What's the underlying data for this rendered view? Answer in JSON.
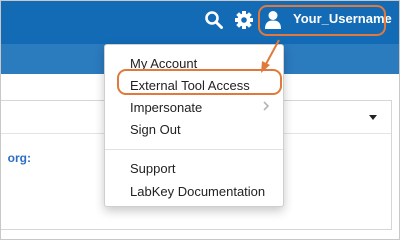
{
  "colors": {
    "header_bg": "#136bb5",
    "subbar_bg": "#2b7bbf",
    "annotation": "#e07a3c",
    "link": "#2b6cc4"
  },
  "header": {
    "icons": [
      "search-icon",
      "gear-icon",
      "user-icon"
    ],
    "username": "Your_Username"
  },
  "panel": {
    "fragment_text": "org:"
  },
  "user_menu": {
    "items": [
      {
        "label": "My Account",
        "highlighted": false
      },
      {
        "label": "External Tool Access",
        "highlighted": true
      },
      {
        "label": "Impersonate",
        "has_submenu": true
      },
      {
        "label": "Sign Out"
      }
    ],
    "secondary_items": [
      {
        "label": "Support"
      },
      {
        "label": "LabKey Documentation"
      }
    ]
  }
}
